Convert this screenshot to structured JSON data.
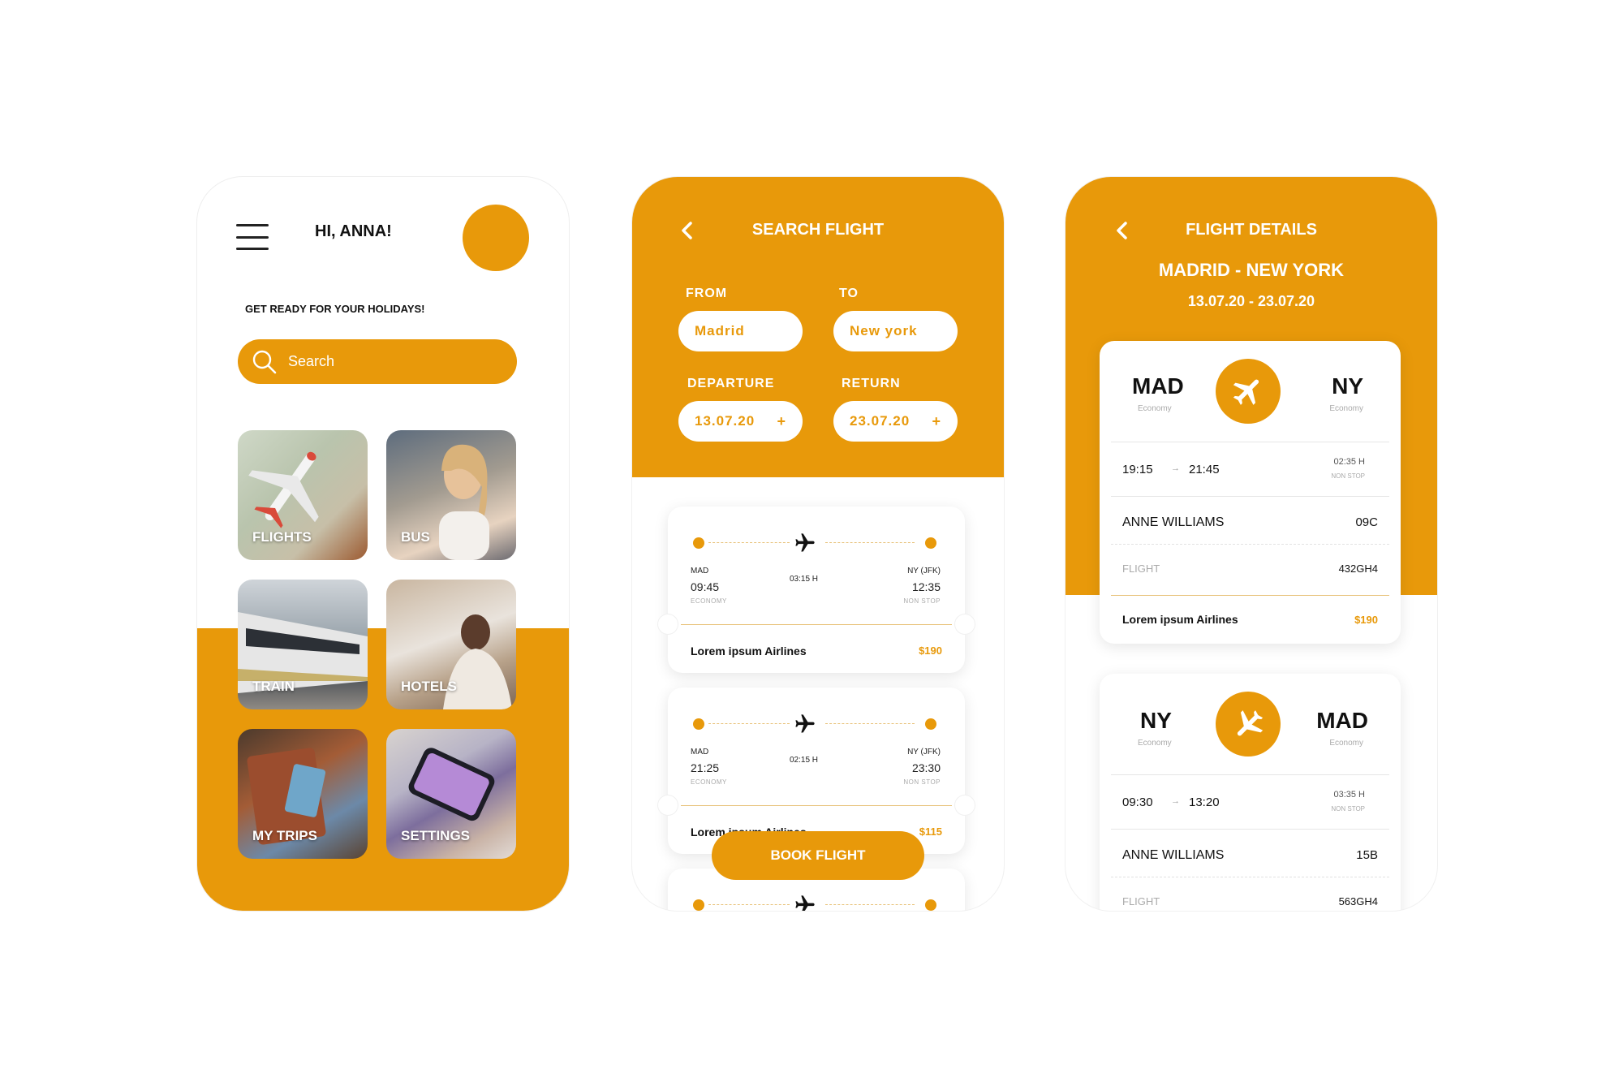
{
  "colors": {
    "accent": "#e8990a",
    "background": "#ffffff"
  },
  "home": {
    "greeting": "HI, ANNA!",
    "tagline": "GET READY FOR YOUR HOLIDAYS!",
    "search_placeholder": "Search",
    "tiles": [
      {
        "label": "FLIGHTS",
        "icon": "airplane-photo"
      },
      {
        "label": "BUS",
        "icon": "bus-photo"
      },
      {
        "label": "TRAIN",
        "icon": "train-photo"
      },
      {
        "label": "HOTELS",
        "icon": "hotel-photo"
      },
      {
        "label": "MY TRIPS",
        "icon": "passport-photo"
      },
      {
        "label": "SETTINGS",
        "icon": "phone-photo"
      }
    ]
  },
  "search": {
    "title": "SEARCH FLIGHT",
    "from_label": "FROM",
    "from_value": "Madrid",
    "to_label": "TO",
    "to_value": "New york",
    "departure_label": "DEPARTURE",
    "departure_value": "13.07.20",
    "return_label": "RETURN",
    "return_value": "23.07.20",
    "results": [
      {
        "from_code": "MAD",
        "to_code": "NY (JFK)",
        "depart": "09:45",
        "arrive": "12:35",
        "duration": "03:15 H",
        "cabin": "ECONOMY",
        "stops": "NON STOP",
        "airline": "Lorem ipsum Airlines",
        "price": "$190"
      },
      {
        "from_code": "MAD",
        "to_code": "NY (JFK)",
        "depart": "21:25",
        "arrive": "23:30",
        "duration": "02:15 H",
        "cabin": "ECONOMY",
        "stops": "NON STOP",
        "airline": "Lorem ipsum Airlines",
        "price": "$115"
      }
    ],
    "book_button": "BOOK FLIGHT"
  },
  "details": {
    "title": "FLIGHT DETAILS",
    "route": "MADRID - NEW YORK",
    "dates": "13.07.20 - 23.07.20",
    "outbound": {
      "from_code": "MAD",
      "from_class": "Economy",
      "to_code": "NY",
      "to_class": "Economy",
      "depart": "19:15",
      "arrive": "21:45",
      "duration": "02:35 H",
      "stops": "NON STOP",
      "passenger": "ANNE WILLIAMS",
      "seat": "09C",
      "flight_label": "FLIGHT",
      "flight_no": "432GH4",
      "airline": "Lorem ipsum Airlines",
      "price": "$190"
    },
    "inbound": {
      "from_code": "NY",
      "from_class": "Economy",
      "to_code": "MAD",
      "to_class": "Economy",
      "depart": "09:30",
      "arrive": "13:20",
      "duration": "03:35 H",
      "stops": "NON STOP",
      "passenger": "ANNE WILLIAMS",
      "seat": "15B",
      "flight_label": "FLIGHT",
      "flight_no": "563GH4"
    }
  }
}
